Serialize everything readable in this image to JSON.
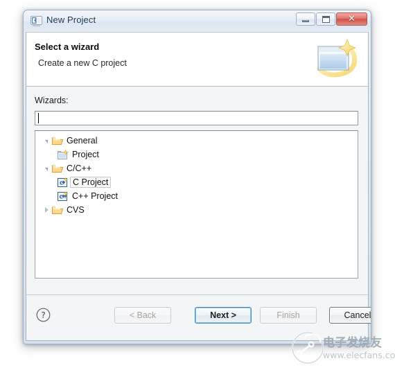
{
  "window": {
    "title": "New Project",
    "app_icon": "eclipse-icon",
    "controls": {
      "minimize": "minimize-button",
      "maximize": "maximize-button",
      "close": "close-button",
      "close_glyph": "✕"
    }
  },
  "header": {
    "title": "Select a wizard",
    "subtitle": "Create a new C project",
    "banner_icon": "new-wizard-banner-icon"
  },
  "body": {
    "wizards_label": "Wizards:",
    "filter": {
      "value": "",
      "placeholder": ""
    },
    "tree": [
      {
        "label": "General",
        "icon": "folder-icon",
        "state": "expanded",
        "indent": 0,
        "selected": false
      },
      {
        "label": "Project",
        "icon": "new-project-icon",
        "state": "leaf",
        "indent": 1,
        "selected": false
      },
      {
        "label": "C/C++",
        "icon": "folder-icon",
        "state": "expanded",
        "indent": 0,
        "selected": false
      },
      {
        "label": "C Project",
        "icon": "c-project-icon",
        "state": "leaf",
        "indent": 1,
        "selected": true
      },
      {
        "label": "C++ Project",
        "icon": "cpp-project-icon",
        "state": "leaf",
        "indent": 1,
        "selected": false
      },
      {
        "label": "CVS",
        "icon": "folder-icon",
        "state": "collapsed",
        "indent": 0,
        "selected": false
      }
    ]
  },
  "buttons": {
    "help": "?",
    "back": {
      "label": "< Back",
      "enabled": false,
      "focused": false
    },
    "next": {
      "label": "Next >",
      "enabled": true,
      "focused": true
    },
    "finish": {
      "label": "Finish",
      "enabled": false,
      "focused": false
    },
    "cancel": {
      "label": "Cancel",
      "enabled": true,
      "focused": false
    }
  },
  "watermark": {
    "brand": "电子发烧友",
    "url": "www.elecfans.com"
  },
  "colors": {
    "accent": "#3c8ccd",
    "close_red": "#cf4f45",
    "folder_orange": "#e9a73a",
    "icon_blue": "#3a6ea5"
  }
}
